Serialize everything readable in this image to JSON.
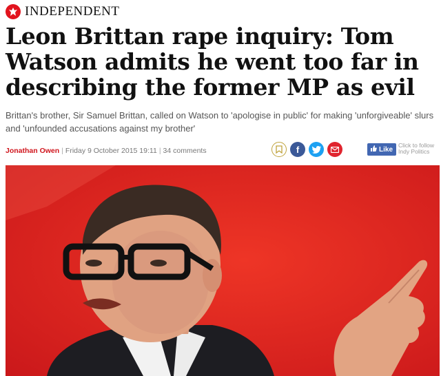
{
  "masthead": {
    "brand": "INDEPENDENT",
    "logo_icon": "eagle-icon",
    "accent": "#e2141e"
  },
  "article": {
    "headline": "Leon Brittan rape inquiry: Tom Watson admits he went too far in describing the former MP as evil",
    "standfirst": "Brittan's brother, Sir Samuel Brittan, called on Watson to 'apologise in public' for making 'unforgiveable' slurs and 'unfounded accusations against my brother'",
    "byline": {
      "author": "Jonathan Owen",
      "date": "Friday 9 October 2015 19:11",
      "comments": "34 comments"
    }
  },
  "share": {
    "icons": [
      "bookmark-icon",
      "facebook-icon",
      "twitter-icon",
      "email-icon"
    ],
    "facebook_glyph": "f",
    "like_label": "Like",
    "follow_line1": "Click to follow",
    "follow_line2": "Indy Politics"
  },
  "hero": {
    "background": "#e1261d"
  }
}
